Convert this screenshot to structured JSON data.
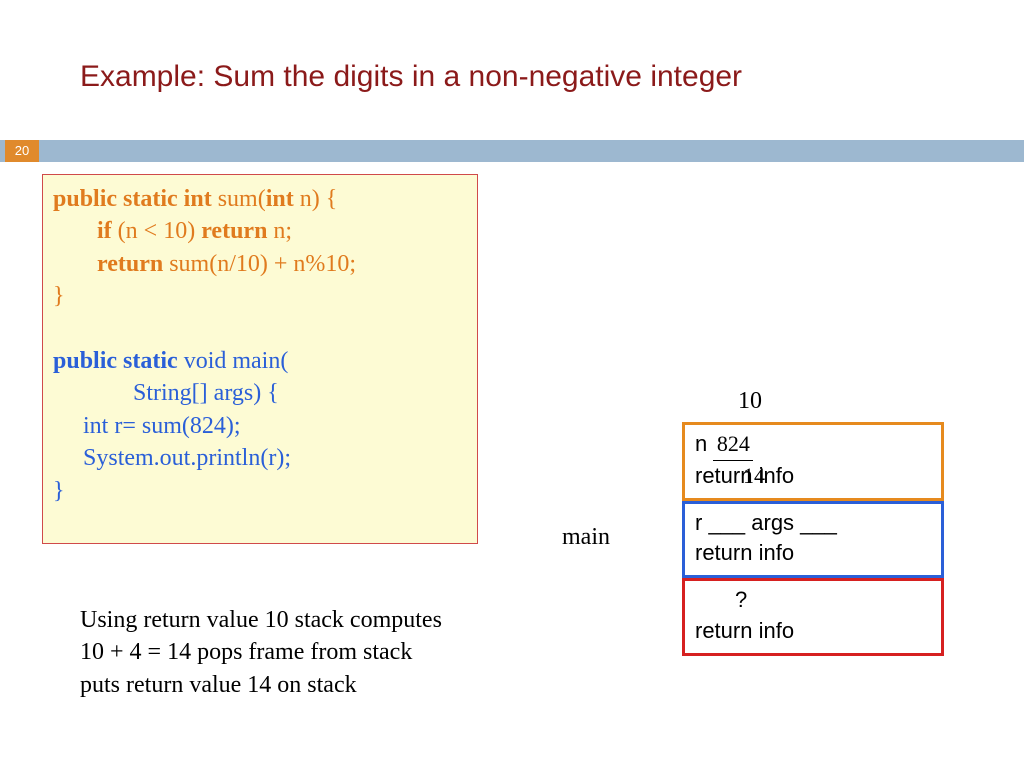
{
  "title": "Example: Sum the digits in a non-negative integer",
  "page_number": "20",
  "code": {
    "l1a": "public static int ",
    "l1b": "sum(",
    "l1c": "int ",
    "l1d": "n) {",
    "l2a": "if ",
    "l2b": "(n < 10) ",
    "l2c": "return ",
    "l2d": "n;",
    "l3a": "return ",
    "l3b": "sum(n/10)  +  n%10;",
    "l4": "}",
    "l5a": "public static ",
    "l5b": "void main(",
    "l6": "String[] args) {",
    "l7": "int r= sum(824);",
    "l8": "System.out.println(r);",
    "l9": "}"
  },
  "explain": {
    "line1": "Using return value 10 stack computes",
    "line2": " 10 + 4 = 14 pops frame from stack",
    "line3": "puts return value 14 on stack"
  },
  "stack": {
    "ten": "10",
    "main_label": "main",
    "frame1": {
      "n_label": "n ",
      "n_value": "824",
      "ret": "return info",
      "overlay": "14"
    },
    "frame2": {
      "vars": "r ___  args ___",
      "ret": "return info"
    },
    "frame3": {
      "q": "?",
      "ret": "return info"
    }
  }
}
